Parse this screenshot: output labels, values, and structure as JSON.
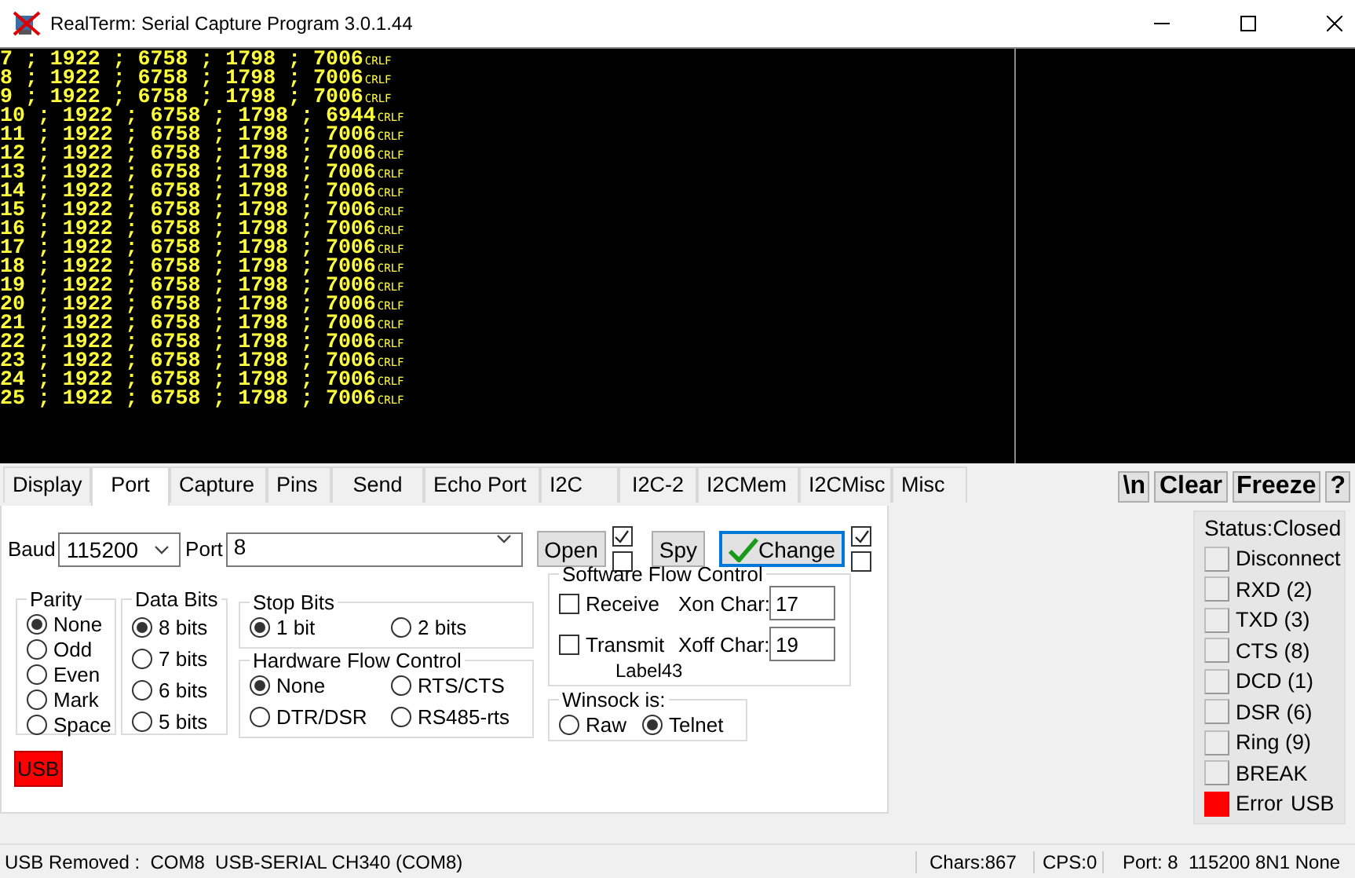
{
  "window": {
    "title": "RealTerm: Serial Capture Program 3.0.1.44"
  },
  "terminal": {
    "lines": [
      {
        "text": "7 ; 1922 ; 6758 ; 1798 ; 7006",
        "eol": "CRLF"
      },
      {
        "text": "8 ; 1922 ; 6758 ; 1798 ; 7006",
        "eol": "CRLF"
      },
      {
        "text": "9 ; 1922 ; 6758 ; 1798 ; 7006",
        "eol": "CRLF"
      },
      {
        "text": "10 ; 1922 ; 6758 ; 1798 ; 6944",
        "eol": "CRLF"
      },
      {
        "text": "11 ; 1922 ; 6758 ; 1798 ; 7006",
        "eol": "CRLF"
      },
      {
        "text": "12 ; 1922 ; 6758 ; 1798 ; 7006",
        "eol": "CRLF"
      },
      {
        "text": "13 ; 1922 ; 6758 ; 1798 ; 7006",
        "eol": "CRLF"
      },
      {
        "text": "14 ; 1922 ; 6758 ; 1798 ; 7006",
        "eol": "CRLF"
      },
      {
        "text": "15 ; 1922 ; 6758 ; 1798 ; 7006",
        "eol": "CRLF"
      },
      {
        "text": "16 ; 1922 ; 6758 ; 1798 ; 7006",
        "eol": "CRLF"
      },
      {
        "text": "17 ; 1922 ; 6758 ; 1798 ; 7006",
        "eol": "CRLF"
      },
      {
        "text": "18 ; 1922 ; 6758 ; 1798 ; 7006",
        "eol": "CRLF"
      },
      {
        "text": "19 ; 1922 ; 6758 ; 1798 ; 7006",
        "eol": "CRLF"
      },
      {
        "text": "20 ; 1922 ; 6758 ; 1798 ; 7006",
        "eol": "CRLF"
      },
      {
        "text": "21 ; 1922 ; 6758 ; 1798 ; 7006",
        "eol": "CRLF"
      },
      {
        "text": "22 ; 1922 ; 6758 ; 1798 ; 7006",
        "eol": "CRLF"
      },
      {
        "text": "23 ; 1922 ; 6758 ; 1798 ; 7006",
        "eol": "CRLF"
      },
      {
        "text": "24 ; 1922 ; 6758 ; 1798 ; 7006",
        "eol": "CRLF"
      },
      {
        "text": "25 ; 1922 ; 6758 ; 1798 ; 7006",
        "eol": "CRLF"
      }
    ]
  },
  "tabs": [
    {
      "label": "Display",
      "selected": false
    },
    {
      "label": "Port",
      "selected": true
    },
    {
      "label": "Capture",
      "selected": false
    },
    {
      "label": "Pins",
      "selected": false
    },
    {
      "label": "Send",
      "selected": false
    },
    {
      "label": "Echo Port",
      "selected": false
    },
    {
      "label": "I2C",
      "selected": false
    },
    {
      "label": "I2C-2",
      "selected": false
    },
    {
      "label": "I2CMem",
      "selected": false
    },
    {
      "label": "I2CMisc",
      "selected": false
    },
    {
      "label": "Misc",
      "selected": false
    }
  ],
  "toolbar_buttons": [
    {
      "label": "\\n"
    },
    {
      "label": "Clear"
    },
    {
      "label": "Freeze"
    },
    {
      "label": "?"
    }
  ],
  "port": {
    "baud": {
      "label": "Baud",
      "value": "115200"
    },
    "port": {
      "label": "Port",
      "value": "8"
    },
    "open_button": "Open",
    "open_checks": [
      {
        "checked": true
      },
      {
        "checked": false
      }
    ],
    "spy_button": "Spy",
    "change_button": "Change",
    "change_checks": [
      {
        "checked": true
      },
      {
        "checked": false
      }
    ],
    "parity": {
      "title": "Parity",
      "options": [
        {
          "label": "None",
          "selected": true
        },
        {
          "label": "Odd",
          "selected": false
        },
        {
          "label": "Even",
          "selected": false
        },
        {
          "label": "Mark",
          "selected": false
        },
        {
          "label": "Space",
          "selected": false
        }
      ]
    },
    "data_bits": {
      "title": "Data Bits",
      "options": [
        {
          "label": "8 bits",
          "selected": true
        },
        {
          "label": "7 bits",
          "selected": false
        },
        {
          "label": "6 bits",
          "selected": false
        },
        {
          "label": "5 bits",
          "selected": false
        }
      ]
    },
    "stop_bits": {
      "title": "Stop Bits",
      "options": [
        {
          "label": "1 bit",
          "selected": true
        },
        {
          "label": "2 bits",
          "selected": false
        }
      ]
    },
    "hardware_flow": {
      "title": "Hardware Flow Control",
      "options": [
        {
          "label": "None",
          "selected": true
        },
        {
          "label": "RTS/CTS",
          "selected": false
        },
        {
          "label": "DTR/DSR",
          "selected": false
        },
        {
          "label": "RS485-rts",
          "selected": false
        }
      ]
    },
    "software_flow": {
      "title": "Software Flow Control",
      "receive": {
        "label": "Receive",
        "checked": false
      },
      "transmit": {
        "label": "Transmit",
        "checked": false
      },
      "xon": {
        "label": "Xon Char:",
        "value": "17"
      },
      "xoff": {
        "label": "Xoff Char:",
        "value": "19"
      }
    },
    "label43": "Label43",
    "winsock": {
      "title": "Winsock is:",
      "options": [
        {
          "label": "Raw",
          "selected": false
        },
        {
          "label": "Telnet",
          "selected": true
        }
      ]
    },
    "usb_badge": "USB"
  },
  "status_panel": {
    "title": "Status:Closed",
    "indicators": [
      {
        "label": "Disconnect",
        "lit": false
      },
      {
        "label": "RXD (2)",
        "lit": false
      },
      {
        "label": "TXD (3)",
        "lit": false
      },
      {
        "label": "CTS (8)",
        "lit": false
      },
      {
        "label": "DCD (1)",
        "lit": false
      },
      {
        "label": "DSR (6)",
        "lit": false
      },
      {
        "label": "Ring (9)",
        "lit": false
      },
      {
        "label": "BREAK",
        "lit": false
      },
      {
        "label": "Error",
        "lit": true
      }
    ],
    "note": "USB"
  },
  "status_bar": [
    "USB Removed :  COM8  USB-SERIAL CH340 (COM8)",
    "Chars:867",
    "CPS:0",
    "Port: 8  115200 8N1 None"
  ]
}
